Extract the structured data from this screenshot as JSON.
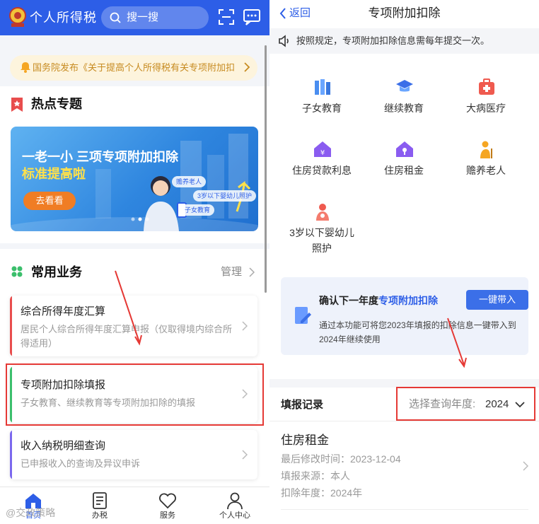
{
  "left": {
    "header": {
      "app_title": "个人所得税",
      "search_placeholder": "搜一搜"
    },
    "notice": {
      "text": "国务院发布《关于提高个人所得税有关专项附加扣"
    },
    "hot_topics": {
      "title": "热点专题",
      "banner": {
        "line1": "一老一小 三项专项附加扣除",
        "line2": "标准提高啦",
        "button": "去看看",
        "tags": [
          "赡养老人",
          "3岁以下婴幼儿照护",
          "子女教育"
        ]
      }
    },
    "common_services": {
      "title": "常用业务",
      "manage_label": "管理",
      "items": [
        {
          "title": "综合所得年度汇算",
          "subtitle": "居民个人综合所得年度汇算申报（仅取得境内综合所得适用）",
          "accent": "#e84d4d"
        },
        {
          "title": "专项附加扣除填报",
          "subtitle": "子女教育、继续教育等专项附加扣除的填报",
          "accent": "#3bbf6c"
        },
        {
          "title": "收入纳税明细查询",
          "subtitle": "已申报收入的查询及异议申诉",
          "accent": "#7b68ee"
        }
      ]
    },
    "tabbar": {
      "items": [
        {
          "label": "首页",
          "icon": "home-icon",
          "active": true
        },
        {
          "label": "办税",
          "icon": "document-icon",
          "active": false
        },
        {
          "label": "服务",
          "icon": "heart-icon",
          "active": false
        },
        {
          "label": "个人中心",
          "icon": "person-icon",
          "active": false
        }
      ]
    },
    "watermark": "@交政策略"
  },
  "right": {
    "nav": {
      "back_label": "返回",
      "title": "专项附加扣除"
    },
    "tip": "按照规定，专项附加扣除信息需每年提交一次。",
    "categories": [
      {
        "label": "子女教育",
        "icon": "books-icon"
      },
      {
        "label": "继续教育",
        "icon": "graduation-cap-icon"
      },
      {
        "label": "大病医疗",
        "icon": "medical-kit-icon"
      },
      {
        "label": "住房贷款利息",
        "icon": "house-yuan-icon"
      },
      {
        "label": "住房租金",
        "icon": "house-key-icon"
      },
      {
        "label": "赡养老人",
        "icon": "elderly-icon"
      },
      {
        "label": "3岁以下婴幼儿照护",
        "icon": "infant-care-icon"
      }
    ],
    "confirm_card": {
      "title_prefix": "确认下一年度",
      "title_highlight": "专项附加扣除",
      "button": "一键带入",
      "description": "通过本功能可将您2023年填报的扣除信息一键带入到2024年继续使用"
    },
    "records": {
      "title": "填报记录",
      "year_label": "选择查询年度:",
      "year_value": "2024",
      "items": [
        {
          "title": "住房租金",
          "last_modified": "最后修改时间：2023-12-04",
          "source": "填报来源：本人",
          "year": "扣除年度：2024年"
        }
      ]
    }
  },
  "colors": {
    "brand_blue": "#2d5ee7",
    "highlight_red": "#e53935",
    "notice_orange": "#c78b21"
  }
}
